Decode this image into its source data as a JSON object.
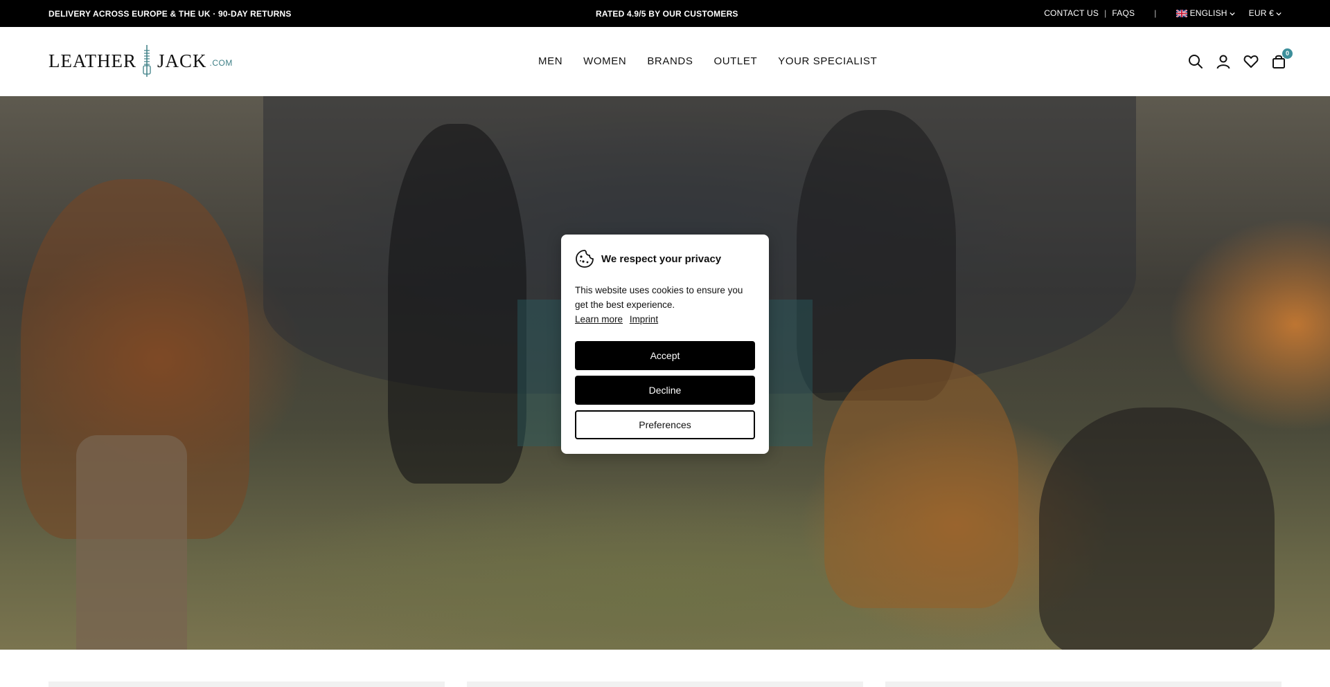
{
  "topbar": {
    "left_text": "DELIVERY ACROSS EUROPE & THE UK · 90-DAY RETURNS",
    "center_text": "RATED 4.9/5 BY OUR CUSTOMERS",
    "contact_label": "CONTACT US",
    "faqs_label": "FAQS",
    "separator": "|",
    "language_label": "ENGLISH",
    "currency_label": "EUR €"
  },
  "header": {
    "logo": {
      "part1": "LEATHER",
      "part2": "JACK",
      "suffix": ".COM"
    },
    "nav": [
      {
        "label": "MEN"
      },
      {
        "label": "WOMEN"
      },
      {
        "label": "BRANDS"
      },
      {
        "label": "OUTLET"
      },
      {
        "label": "YOUR SPECIALIST"
      }
    ],
    "icons": [
      "search-icon",
      "account-icon",
      "wishlist-icon",
      "cart-icon"
    ],
    "cart_count": "0"
  },
  "cookie_banner": {
    "title": "We respect your privacy",
    "message": "This website uses cookies to ensure you get the best experience.",
    "learn_more_label": "Learn more",
    "imprint_label": "Imprint",
    "accept_label": "Accept",
    "decline_label": "Decline",
    "preferences_label": "Preferences"
  },
  "colors": {
    "topbar_bg": "#000000",
    "accent": "#3d8f9b",
    "button_dark": "#000000"
  }
}
